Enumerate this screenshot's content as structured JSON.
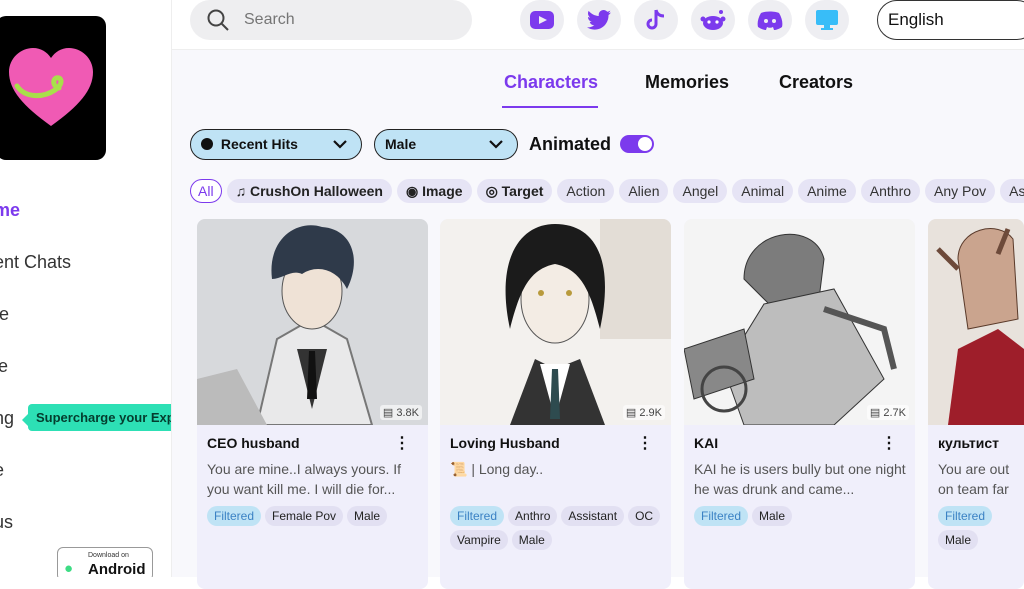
{
  "sidebar": {
    "items": [
      {
        "label": "me",
        "active": true
      },
      {
        "label": "ent Chats"
      },
      {
        "label": "te"
      },
      {
        "label": "le"
      },
      {
        "label": "ng"
      },
      {
        "label": "e"
      },
      {
        "label": "us"
      }
    ],
    "tooltip": "Supercharge your Experience",
    "android_small": "Download on",
    "android_big": "Android"
  },
  "search": {
    "placeholder": "Search"
  },
  "social": [
    "youtube-icon",
    "twitter-icon",
    "tiktok-icon",
    "reddit-icon",
    "discord-icon",
    "desktop-icon"
  ],
  "language": "English",
  "tabs": [
    "Characters",
    "Memories",
    "Creators"
  ],
  "filters": {
    "sort": "Recent Hits",
    "gender": "Male",
    "animated_label": "Animated",
    "animated_on": true
  },
  "chips": [
    "All",
    "CrushOn Halloween",
    "Image",
    "Target",
    "Action",
    "Alien",
    "Angel",
    "Animal",
    "Anime",
    "Anthro",
    "Any Pov",
    "As"
  ],
  "cards": [
    {
      "name": "CEO husband",
      "count": "3.8K",
      "desc": "You are mine..I always yours. If you want kill me. I will die for...",
      "tags": [
        "Filtered",
        "Female Pov",
        "Male"
      ]
    },
    {
      "name": "Loving Husband",
      "count": "2.9K",
      "desc": "📜 | Long day..",
      "tags": [
        "Filtered",
        "Anthro",
        "Assistant",
        "OC",
        "Vampire",
        "Male"
      ]
    },
    {
      "name": "KAI",
      "count": "2.7K",
      "desc": "KAI he is users bully but one night he was drunk and came...",
      "tags": [
        "Filtered",
        "Male"
      ]
    },
    {
      "name": "культист",
      "count": "",
      "desc": "You are out on team far from",
      "tags": [
        "Filtered",
        "Male"
      ]
    }
  ],
  "colors": {
    "accent": "#7c3aed",
    "chip": "#e6e4f5",
    "filter_blue": "#bfe3f5"
  }
}
